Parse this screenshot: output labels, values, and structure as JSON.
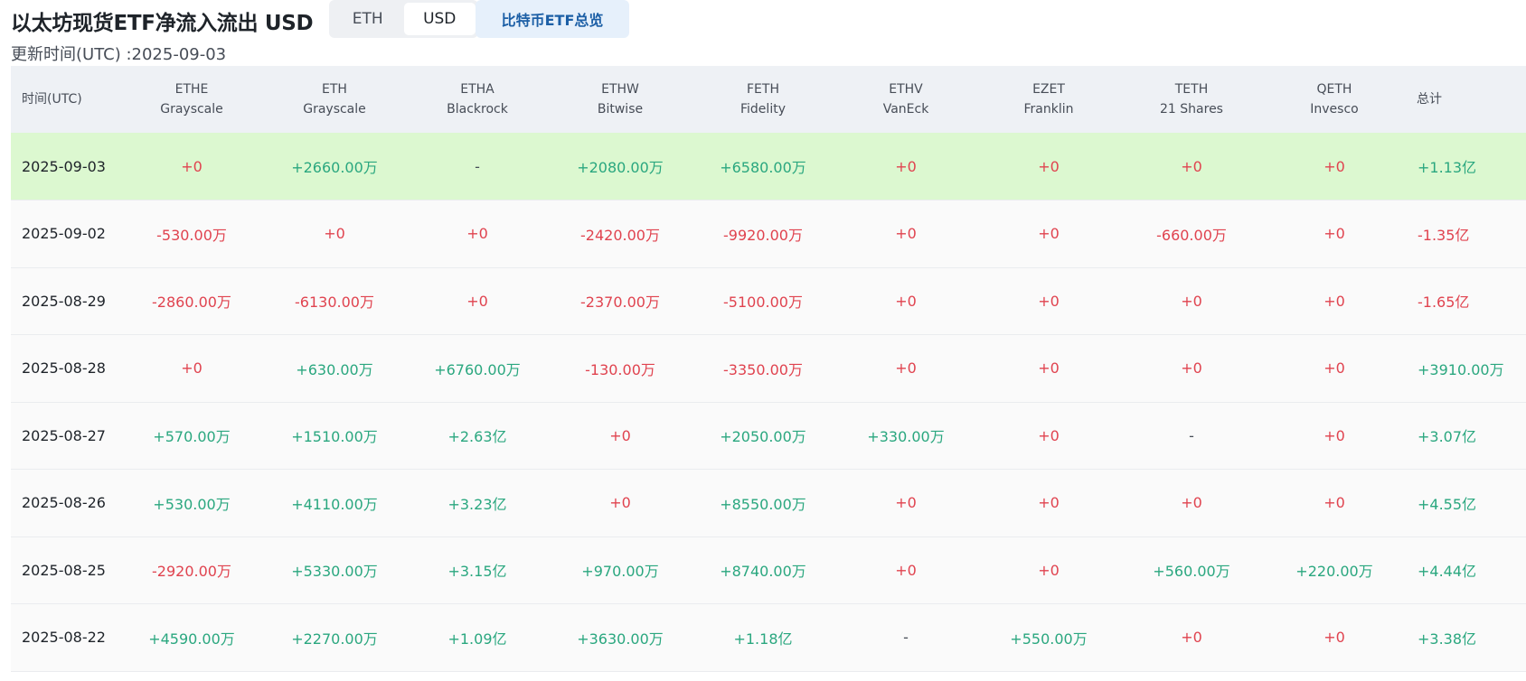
{
  "header": {
    "title": "以太坊现货ETF净流入流出 USD",
    "unit_options": [
      "ETH",
      "USD"
    ],
    "unit_selected": "USD",
    "btc_overview_label": "比特币ETF总览",
    "updated_label": "更新时间(UTC) :2025-09-03"
  },
  "colors": {
    "positive": "#2aa77f",
    "negative": "#e0434f",
    "highlight_row": "#dcf8d0",
    "header_bg": "#eef1f5",
    "btc_button_bg": "#e6f0fb",
    "btc_button_text": "#1c5fa6"
  },
  "table": {
    "date_header": "时间(UTC)",
    "total_header": "总计",
    "columns": [
      {
        "ticker": "ETHE",
        "issuer": "Grayscale"
      },
      {
        "ticker": "ETH",
        "issuer": "Grayscale"
      },
      {
        "ticker": "ETHA",
        "issuer": "Blackrock"
      },
      {
        "ticker": "ETHW",
        "issuer": "Bitwise"
      },
      {
        "ticker": "FETH",
        "issuer": "Fidelity"
      },
      {
        "ticker": "ETHV",
        "issuer": "VanEck"
      },
      {
        "ticker": "EZET",
        "issuer": "Franklin"
      },
      {
        "ticker": "TETH",
        "issuer": "21 Shares"
      },
      {
        "ticker": "QETH",
        "issuer": "Invesco"
      }
    ],
    "rows": [
      {
        "date": "2025-09-03",
        "highlight": true,
        "values": [
          "+0",
          "+2660.00万",
          "-",
          "+2080.00万",
          "+6580.00万",
          "+0",
          "+0",
          "+0",
          "+0"
        ],
        "total": "+1.13亿"
      },
      {
        "date": "2025-09-02",
        "highlight": false,
        "values": [
          "-530.00万",
          "+0",
          "+0",
          "-2420.00万",
          "-9920.00万",
          "+0",
          "+0",
          "-660.00万",
          "+0"
        ],
        "total": "-1.35亿"
      },
      {
        "date": "2025-08-29",
        "highlight": false,
        "values": [
          "-2860.00万",
          "-6130.00万",
          "+0",
          "-2370.00万",
          "-5100.00万",
          "+0",
          "+0",
          "+0",
          "+0"
        ],
        "total": "-1.65亿"
      },
      {
        "date": "2025-08-28",
        "highlight": false,
        "values": [
          "+0",
          "+630.00万",
          "+6760.00万",
          "-130.00万",
          "-3350.00万",
          "+0",
          "+0",
          "+0",
          "+0"
        ],
        "total": "+3910.00万"
      },
      {
        "date": "2025-08-27",
        "highlight": false,
        "values": [
          "+570.00万",
          "+1510.00万",
          "+2.63亿",
          "+0",
          "+2050.00万",
          "+330.00万",
          "+0",
          "-",
          "+0"
        ],
        "total": "+3.07亿"
      },
      {
        "date": "2025-08-26",
        "highlight": false,
        "values": [
          "+530.00万",
          "+4110.00万",
          "+3.23亿",
          "+0",
          "+8550.00万",
          "+0",
          "+0",
          "+0",
          "+0"
        ],
        "total": "+4.55亿"
      },
      {
        "date": "2025-08-25",
        "highlight": false,
        "values": [
          "-2920.00万",
          "+5330.00万",
          "+3.15亿",
          "+970.00万",
          "+8740.00万",
          "+0",
          "+0",
          "+560.00万",
          "+220.00万"
        ],
        "total": "+4.44亿"
      },
      {
        "date": "2025-08-22",
        "highlight": false,
        "values": [
          "+4590.00万",
          "+2270.00万",
          "+1.09亿",
          "+3630.00万",
          "+1.18亿",
          "-",
          "+550.00万",
          "+0",
          "+0"
        ],
        "total": "+3.38亿"
      }
    ]
  }
}
